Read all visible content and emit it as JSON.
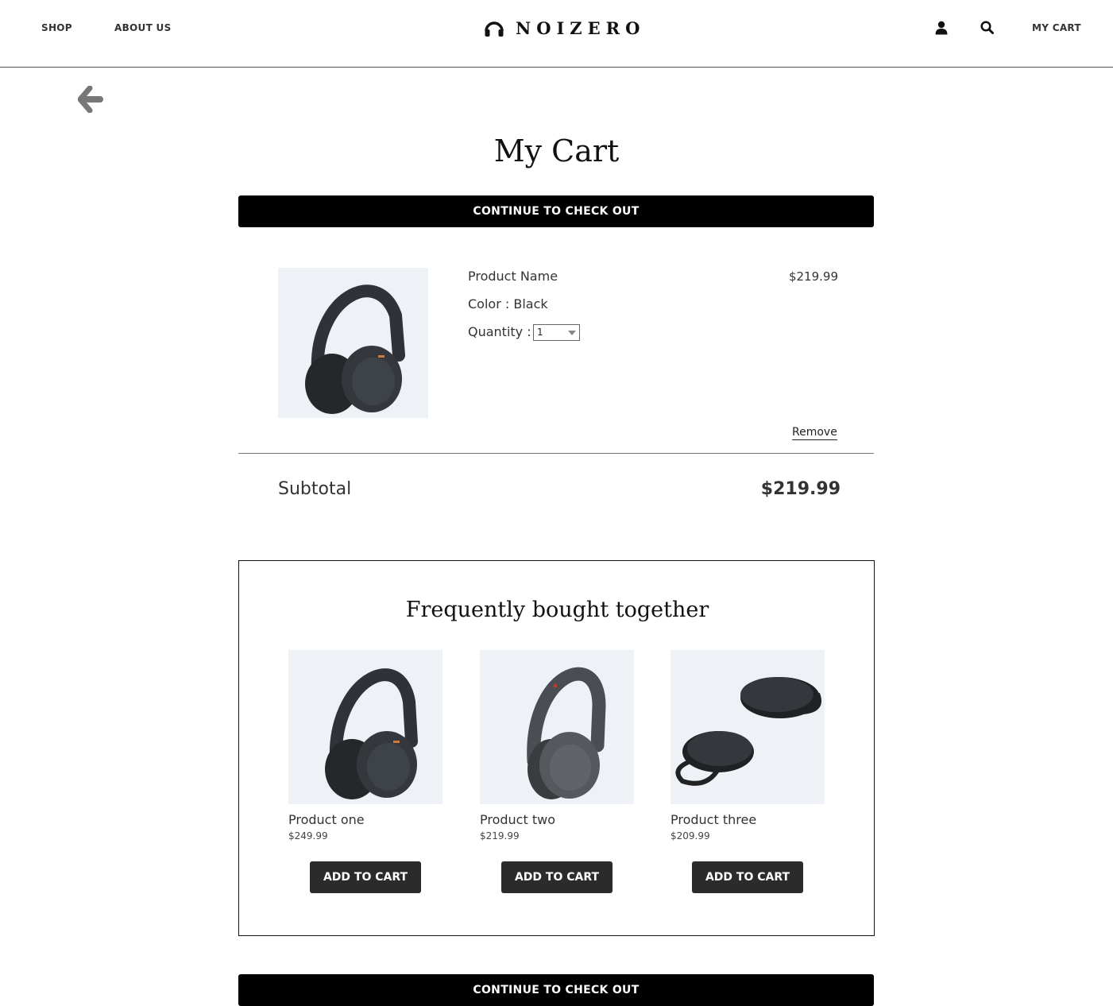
{
  "header": {
    "nav": [
      "SHOP",
      "ABOUT US"
    ],
    "logo_text": "NOIZERO",
    "cart_label": "MY CART"
  },
  "page": {
    "title": "My Cart",
    "checkout_label": "CONTINUE TO CHECK OUT"
  },
  "cart_item": {
    "name": "Product Name",
    "price": "$219.99",
    "color_label": "Color : Black",
    "quantity_label": "Quantity :",
    "quantity_value": "1",
    "remove_label": "Remove"
  },
  "subtotal": {
    "label": "Subtotal",
    "value": "$219.99"
  },
  "frequently_bought": {
    "title": "Frequently bought together",
    "add_label": "ADD TO CART",
    "products": [
      {
        "name": "Product one",
        "price": "$249.99"
      },
      {
        "name": "Product two",
        "price": "$219.99"
      },
      {
        "name": "Product three",
        "price": "$209.99"
      }
    ]
  },
  "icons": [
    "headphones-logo-icon",
    "user-icon",
    "search-icon",
    "back-arrow-icon"
  ]
}
